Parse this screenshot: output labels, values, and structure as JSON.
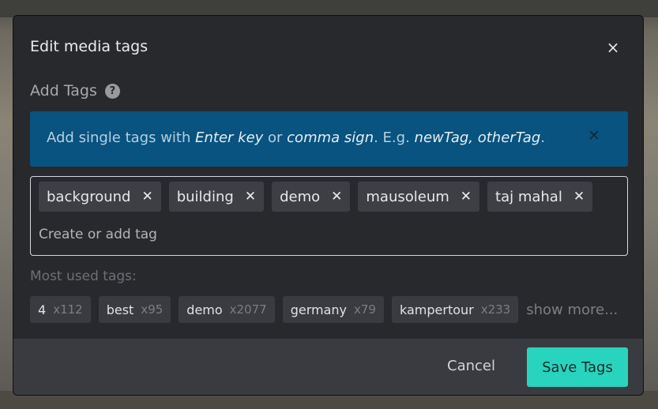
{
  "modal": {
    "title": "Edit media tags",
    "close_icon": "×"
  },
  "add_tags": {
    "label": "Add Tags",
    "help_icon": "?"
  },
  "info": {
    "text_1": "Add single tags with ",
    "em_1": "Enter key",
    "text_2": " or ",
    "em_2": "comma sign",
    "text_3": ". E.g. ",
    "em_3": "newTag, otherTag",
    "text_4": ".",
    "dismiss_icon": "✕"
  },
  "tags": [
    {
      "label": "background"
    },
    {
      "label": "building"
    },
    {
      "label": "demo"
    },
    {
      "label": "mausoleum"
    },
    {
      "label": "taj mahal"
    }
  ],
  "tag_remove_icon": "✕",
  "input": {
    "placeholder": "Create or add tag"
  },
  "most_used": {
    "label": "Most used tags:",
    "items": [
      {
        "name": "4",
        "count": "x112"
      },
      {
        "name": "best",
        "count": "x95"
      },
      {
        "name": "demo",
        "count": "x2077"
      },
      {
        "name": "germany",
        "count": "x79"
      },
      {
        "name": "kampertour",
        "count": "x233"
      }
    ],
    "show_more": "show more..."
  },
  "footer": {
    "cancel_label": "Cancel",
    "save_label": "Save Tags"
  },
  "colors": {
    "modal_bg": "#28292d",
    "info_bg": "#08537f",
    "save_bg": "#28d4bd"
  }
}
